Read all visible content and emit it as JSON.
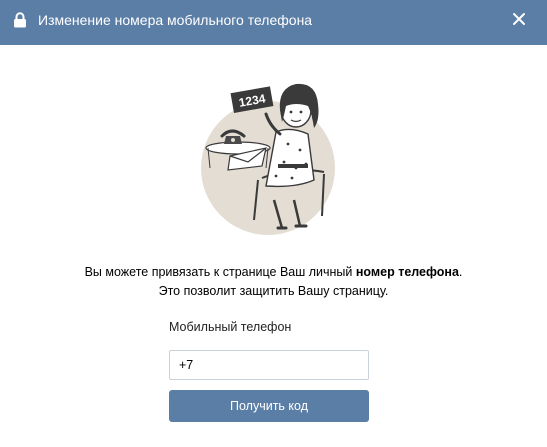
{
  "dialog": {
    "title": "Изменение номера мобильного телефона",
    "lock_icon": "lock-icon",
    "close_icon": "close-icon"
  },
  "illustration": {
    "sign_text": "1234",
    "icon": "woman-with-phone-illustration"
  },
  "description": {
    "line1_prefix": "Вы можете привязать к странице Ваш личный ",
    "line1_bold": "номер телефона",
    "line1_suffix": ".",
    "line2": "Это позволит защитить Вашу страницу."
  },
  "form": {
    "phone_label": "Мобильный телефон",
    "phone_value": "+7",
    "submit_label": "Получить код"
  },
  "colors": {
    "header_bg": "#5b7ea6",
    "button_bg": "#5b7ea6",
    "illustration_bg": "#e3ddd3"
  }
}
